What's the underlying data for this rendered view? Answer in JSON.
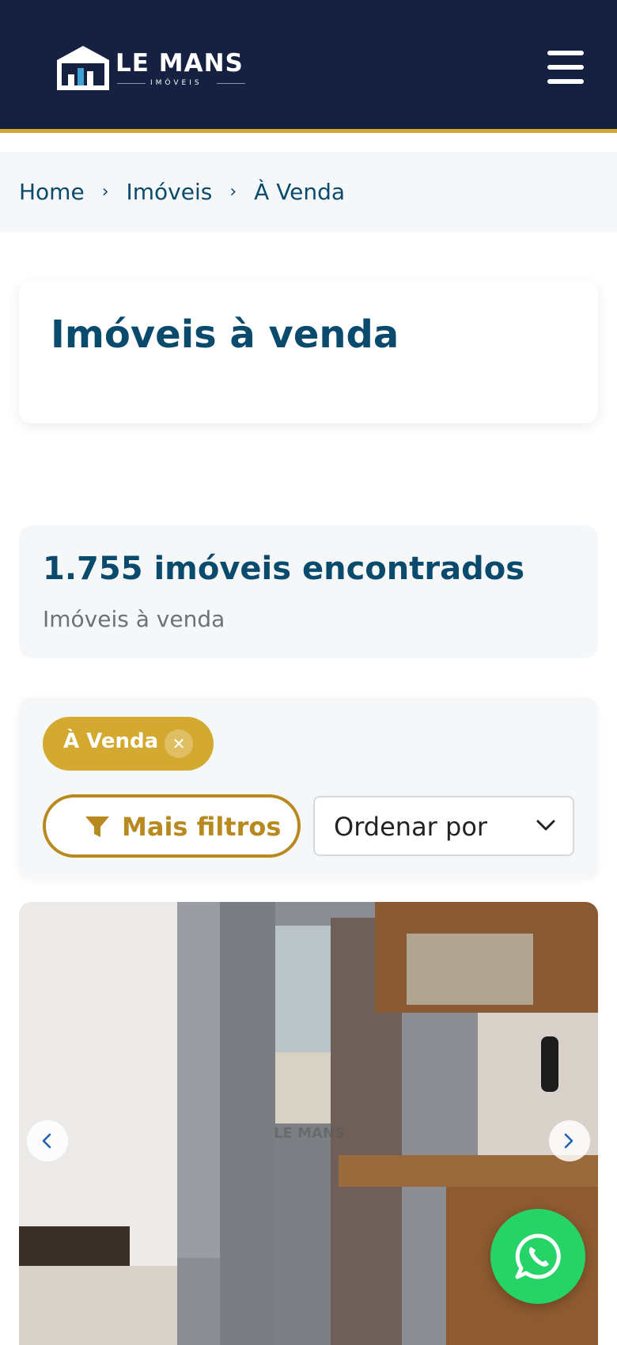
{
  "header": {
    "logo_text": "LE MANS",
    "logo_subtext": "IMÓVEIS",
    "menu_icon": "hamburger-menu-icon"
  },
  "breadcrumb": {
    "items": [
      "Home",
      "Imóveis",
      "À Venda"
    ],
    "separator": "›"
  },
  "page": {
    "title": "Imóveis à venda"
  },
  "results": {
    "count": "1.755",
    "count_suffix": "imóveis encontrados",
    "subtitle": "Imóveis à venda"
  },
  "filters": {
    "active_chip": "À Venda",
    "remove_chip_icon": "close-icon",
    "more_filters_label": "Mais filtros",
    "more_filters_icon": "funnel-icon",
    "sort_label": "Ordenar por",
    "sort_icon": "chevron-down-icon"
  },
  "listing": {
    "watermark": "LE MANS",
    "prev_icon": "chevron-left-icon",
    "next_icon": "chevron-right-icon"
  },
  "whatsapp": {
    "icon": "whatsapp-icon"
  },
  "colors": {
    "header_bg": "#162040",
    "accent_gold": "#d4a930",
    "primary_text": "#0a4a6c",
    "whatsapp_green": "#25d366"
  }
}
